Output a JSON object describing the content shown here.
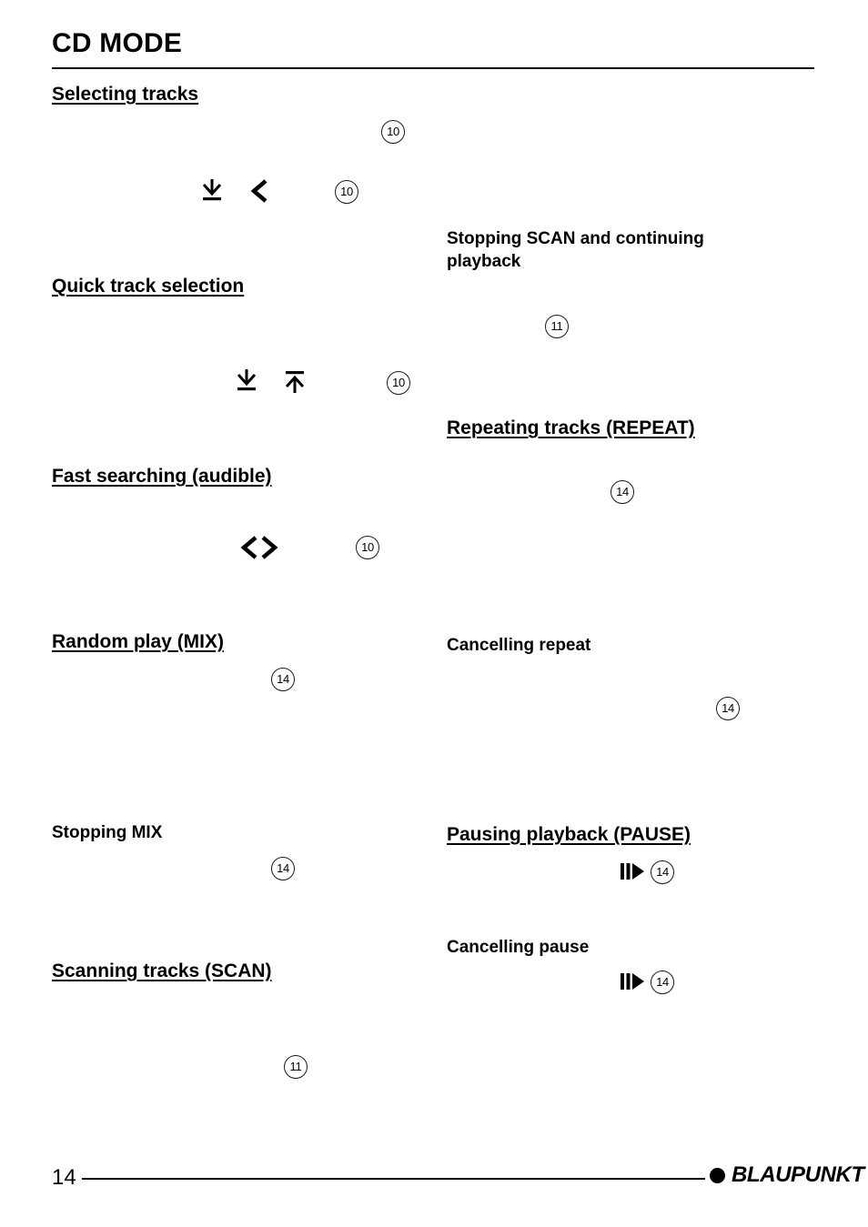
{
  "document": {
    "title": "CD MODE",
    "page_number": "14",
    "brand": "BLAUPUNKT"
  },
  "left_column": {
    "sections": [
      {
        "heading": "Selecting tracks",
        "style": "main"
      },
      {
        "heading": "Quick track selection",
        "style": "main"
      },
      {
        "heading": "Fast searching (audible)",
        "style": "main"
      },
      {
        "heading": "Random play (MIX)",
        "style": "main"
      },
      {
        "heading": "Stopping MIX",
        "style": "sub"
      },
      {
        "heading": "Scanning tracks (SCAN)",
        "style": "main"
      }
    ],
    "callouts": [
      {
        "number": "10"
      },
      {
        "number": "10"
      },
      {
        "number": "10"
      },
      {
        "number": "10"
      },
      {
        "number": "14"
      },
      {
        "number": "14"
      },
      {
        "number": "11"
      }
    ],
    "glyphs": [
      {
        "name": "arrow-down-to-bar-icon",
        "symbol": "↓"
      },
      {
        "name": "chevron-left-icon",
        "symbol": "<"
      },
      {
        "name": "arrow-down-to-bar-icon",
        "symbol": "↓"
      },
      {
        "name": "arrow-up-to-bar-icon",
        "symbol": "↑"
      },
      {
        "name": "seek-left-right-icon",
        "symbol": "<>"
      }
    ]
  },
  "right_column": {
    "sections": [
      {
        "heading": "Stopping SCAN and continuing playback",
        "style": "sub"
      },
      {
        "heading": "Repeating tracks (REPEAT)",
        "style": "main"
      },
      {
        "heading": "Cancelling repeat",
        "style": "sub"
      },
      {
        "heading": "Pausing playback (PAUSE)",
        "style": "main"
      },
      {
        "heading": "Cancelling pause",
        "style": "sub"
      }
    ],
    "callouts": [
      {
        "number": "11"
      },
      {
        "number": "14"
      },
      {
        "number": "14"
      },
      {
        "number": "14"
      },
      {
        "number": "14"
      }
    ],
    "glyphs": [
      {
        "name": "pause-play-icon",
        "symbol": "‖▶"
      },
      {
        "name": "pause-play-icon",
        "symbol": "‖▶"
      }
    ]
  },
  "colors": {
    "text": "#000000",
    "rule": "#000000",
    "background": "#ffffff"
  }
}
